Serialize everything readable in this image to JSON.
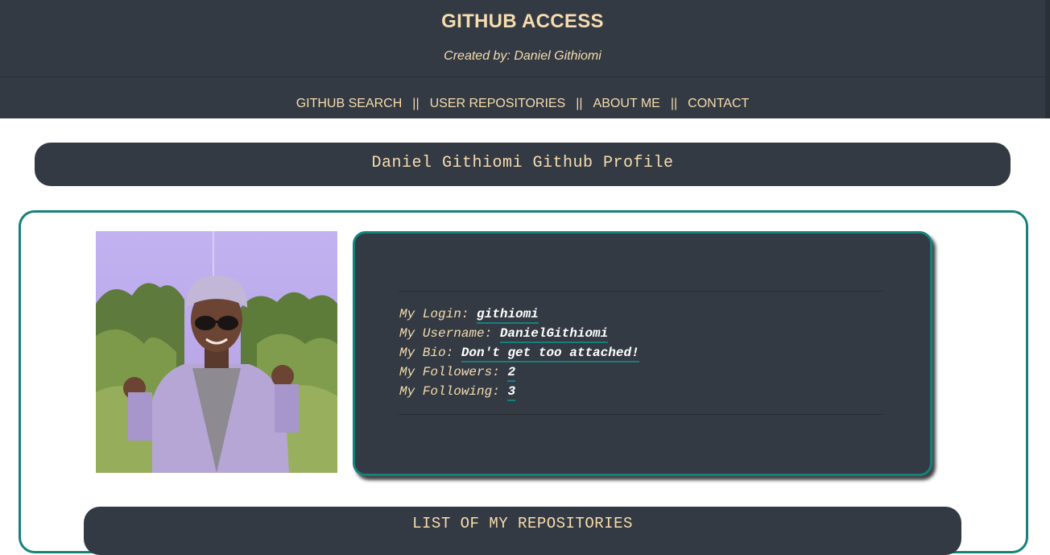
{
  "header": {
    "title": "GITHUB ACCESS",
    "subtitle": "Created by: Daniel Githiomi"
  },
  "nav": {
    "items": [
      {
        "label": "GITHUB SEARCH"
      },
      {
        "label": "USER REPOSITORIES"
      },
      {
        "label": "ABOUT ME"
      },
      {
        "label": "CONTACT"
      }
    ],
    "separator": "||"
  },
  "profile": {
    "banner": "Daniel Githiomi Github Profile",
    "avatar_icon": "profile-photo",
    "fields": [
      {
        "key": "My Login:",
        "value": "githiomi"
      },
      {
        "key": "My Username:",
        "value": "DanielGithiomi"
      },
      {
        "key": "My Bio:",
        "value": "Don't get too attached!"
      },
      {
        "key": "My Followers:",
        "value": "2"
      },
      {
        "key": "My Following:",
        "value": "3"
      }
    ]
  },
  "repositories": {
    "heading": "LIST OF MY REPOSITORIES"
  },
  "colors": {
    "header_bg": "#333a43",
    "accent_text": "#f6dcae",
    "border_teal": "#15817a"
  }
}
